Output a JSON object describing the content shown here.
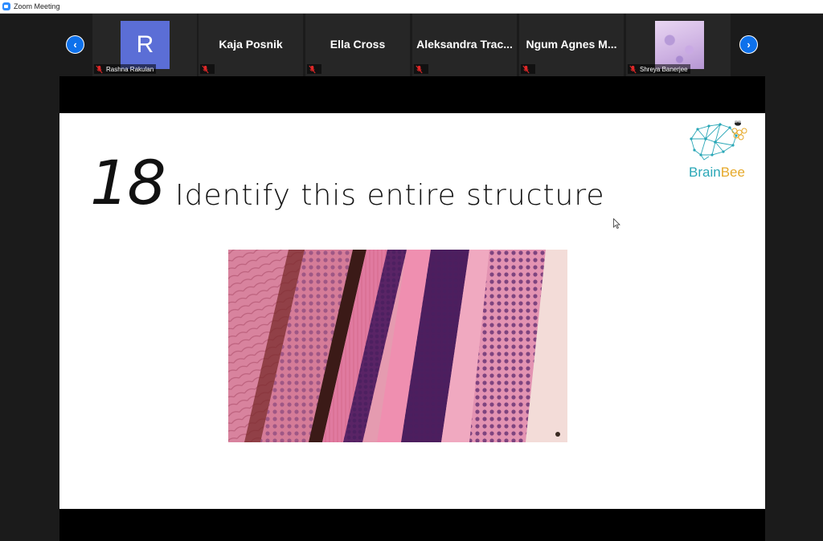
{
  "window": {
    "title": "Zoom Meeting"
  },
  "colors": {
    "accent": "#0e71eb",
    "avatar": "#5b6ed6",
    "logo_teal": "#2aa7b7",
    "logo_gold": "#e6a92a"
  },
  "strip": {
    "prev_icon": "chevron-left-icon",
    "next_icon": "chevron-right-icon",
    "prev_label": "‹",
    "next_label": "›",
    "participants": [
      {
        "name": "Rashna Rakulan",
        "avatar_letter": "R",
        "muted": true
      },
      {
        "name": "Kaja Posnik",
        "muted": true
      },
      {
        "name": "Ella Cross",
        "muted": true
      },
      {
        "name": "Aleksandra  Trac...",
        "muted": true
      },
      {
        "name": "Ngum  Agnes  M...",
        "muted": true
      },
      {
        "name": "Shreya Banerjee",
        "muted": true
      }
    ]
  },
  "slide": {
    "number": "18",
    "heading": "Identify this entire structure",
    "logo": {
      "part1": "Brain",
      "part2": "Bee"
    }
  }
}
